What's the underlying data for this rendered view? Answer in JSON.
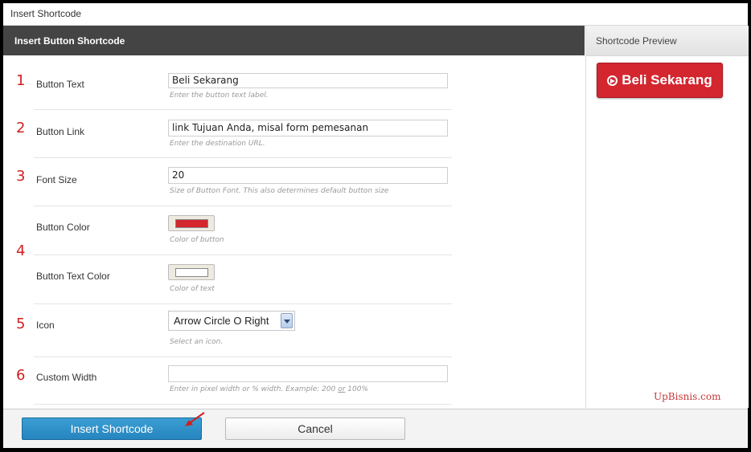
{
  "window": {
    "title": "Insert Shortcode"
  },
  "form": {
    "header": "Insert Button Shortcode",
    "fields": [
      {
        "number": "1",
        "label": "Button Text",
        "value": "Beli Sekarang",
        "hint": "Enter the button text label."
      },
      {
        "number": "2",
        "label": "Button Link",
        "value": "link Tujuan Anda, misal form pemesanan",
        "hint": "Enter the destination URL."
      },
      {
        "number": "3",
        "label": "Font Size",
        "value": "20",
        "hint": "Size of Button Font. This also determines default button size"
      },
      {
        "number": "4",
        "label": "Button Color",
        "color": "#d3262f",
        "hint": "Color of button"
      },
      {
        "label": "Button Text Color",
        "color": "#ffffff",
        "hint": "Color of text"
      },
      {
        "number": "5",
        "label": "Icon",
        "value": "Arrow Circle O Right",
        "hint": "Select an icon."
      },
      {
        "number": "6",
        "label": "Custom Width",
        "value": "",
        "hint_before": "Enter in pixel width or % width. Example: 200 ",
        "hint_or": "or",
        "hint_after": " 100%"
      }
    ]
  },
  "preview": {
    "header": "Shortcode Preview",
    "button_label": "Beli Sekarang",
    "button_icon": "arrow-circle-o-right-icon",
    "button_color": "#d3262f"
  },
  "watermark": "UpBisnis.com",
  "footer": {
    "insert_label": "Insert Shortcode",
    "cancel_label": "Cancel"
  },
  "colors": {
    "accent": "#2a8bc6",
    "number": "#d01f1f",
    "header_bg": "#444444"
  }
}
